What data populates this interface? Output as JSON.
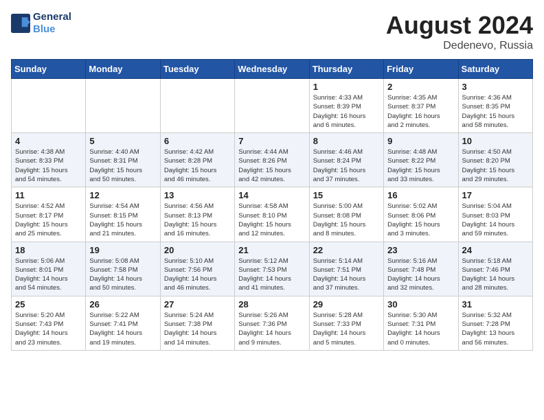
{
  "header": {
    "logo_line1": "General",
    "logo_line2": "Blue",
    "month_year": "August 2024",
    "location": "Dedenevo, Russia"
  },
  "days_of_week": [
    "Sunday",
    "Monday",
    "Tuesday",
    "Wednesday",
    "Thursday",
    "Friday",
    "Saturday"
  ],
  "weeks": [
    [
      {
        "day": "",
        "info": ""
      },
      {
        "day": "",
        "info": ""
      },
      {
        "day": "",
        "info": ""
      },
      {
        "day": "",
        "info": ""
      },
      {
        "day": "1",
        "info": "Sunrise: 4:33 AM\nSunset: 8:39 PM\nDaylight: 16 hours\nand 6 minutes."
      },
      {
        "day": "2",
        "info": "Sunrise: 4:35 AM\nSunset: 8:37 PM\nDaylight: 16 hours\nand 2 minutes."
      },
      {
        "day": "3",
        "info": "Sunrise: 4:36 AM\nSunset: 8:35 PM\nDaylight: 15 hours\nand 58 minutes."
      }
    ],
    [
      {
        "day": "4",
        "info": "Sunrise: 4:38 AM\nSunset: 8:33 PM\nDaylight: 15 hours\nand 54 minutes."
      },
      {
        "day": "5",
        "info": "Sunrise: 4:40 AM\nSunset: 8:31 PM\nDaylight: 15 hours\nand 50 minutes."
      },
      {
        "day": "6",
        "info": "Sunrise: 4:42 AM\nSunset: 8:28 PM\nDaylight: 15 hours\nand 46 minutes."
      },
      {
        "day": "7",
        "info": "Sunrise: 4:44 AM\nSunset: 8:26 PM\nDaylight: 15 hours\nand 42 minutes."
      },
      {
        "day": "8",
        "info": "Sunrise: 4:46 AM\nSunset: 8:24 PM\nDaylight: 15 hours\nand 37 minutes."
      },
      {
        "day": "9",
        "info": "Sunrise: 4:48 AM\nSunset: 8:22 PM\nDaylight: 15 hours\nand 33 minutes."
      },
      {
        "day": "10",
        "info": "Sunrise: 4:50 AM\nSunset: 8:20 PM\nDaylight: 15 hours\nand 29 minutes."
      }
    ],
    [
      {
        "day": "11",
        "info": "Sunrise: 4:52 AM\nSunset: 8:17 PM\nDaylight: 15 hours\nand 25 minutes."
      },
      {
        "day": "12",
        "info": "Sunrise: 4:54 AM\nSunset: 8:15 PM\nDaylight: 15 hours\nand 21 minutes."
      },
      {
        "day": "13",
        "info": "Sunrise: 4:56 AM\nSunset: 8:13 PM\nDaylight: 15 hours\nand 16 minutes."
      },
      {
        "day": "14",
        "info": "Sunrise: 4:58 AM\nSunset: 8:10 PM\nDaylight: 15 hours\nand 12 minutes."
      },
      {
        "day": "15",
        "info": "Sunrise: 5:00 AM\nSunset: 8:08 PM\nDaylight: 15 hours\nand 8 minutes."
      },
      {
        "day": "16",
        "info": "Sunrise: 5:02 AM\nSunset: 8:06 PM\nDaylight: 15 hours\nand 3 minutes."
      },
      {
        "day": "17",
        "info": "Sunrise: 5:04 AM\nSunset: 8:03 PM\nDaylight: 14 hours\nand 59 minutes."
      }
    ],
    [
      {
        "day": "18",
        "info": "Sunrise: 5:06 AM\nSunset: 8:01 PM\nDaylight: 14 hours\nand 54 minutes."
      },
      {
        "day": "19",
        "info": "Sunrise: 5:08 AM\nSunset: 7:58 PM\nDaylight: 14 hours\nand 50 minutes."
      },
      {
        "day": "20",
        "info": "Sunrise: 5:10 AM\nSunset: 7:56 PM\nDaylight: 14 hours\nand 46 minutes."
      },
      {
        "day": "21",
        "info": "Sunrise: 5:12 AM\nSunset: 7:53 PM\nDaylight: 14 hours\nand 41 minutes."
      },
      {
        "day": "22",
        "info": "Sunrise: 5:14 AM\nSunset: 7:51 PM\nDaylight: 14 hours\nand 37 minutes."
      },
      {
        "day": "23",
        "info": "Sunrise: 5:16 AM\nSunset: 7:48 PM\nDaylight: 14 hours\nand 32 minutes."
      },
      {
        "day": "24",
        "info": "Sunrise: 5:18 AM\nSunset: 7:46 PM\nDaylight: 14 hours\nand 28 minutes."
      }
    ],
    [
      {
        "day": "25",
        "info": "Sunrise: 5:20 AM\nSunset: 7:43 PM\nDaylight: 14 hours\nand 23 minutes."
      },
      {
        "day": "26",
        "info": "Sunrise: 5:22 AM\nSunset: 7:41 PM\nDaylight: 14 hours\nand 19 minutes."
      },
      {
        "day": "27",
        "info": "Sunrise: 5:24 AM\nSunset: 7:38 PM\nDaylight: 14 hours\nand 14 minutes."
      },
      {
        "day": "28",
        "info": "Sunrise: 5:26 AM\nSunset: 7:36 PM\nDaylight: 14 hours\nand 9 minutes."
      },
      {
        "day": "29",
        "info": "Sunrise: 5:28 AM\nSunset: 7:33 PM\nDaylight: 14 hours\nand 5 minutes."
      },
      {
        "day": "30",
        "info": "Sunrise: 5:30 AM\nSunset: 7:31 PM\nDaylight: 14 hours\nand 0 minutes."
      },
      {
        "day": "31",
        "info": "Sunrise: 5:32 AM\nSunset: 7:28 PM\nDaylight: 13 hours\nand 56 minutes."
      }
    ]
  ]
}
